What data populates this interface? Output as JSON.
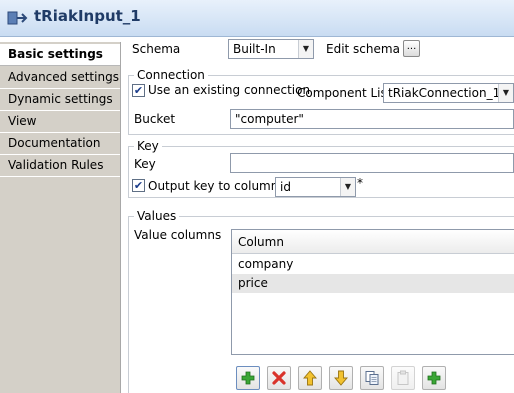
{
  "window": {
    "title": "tRiakInput_1"
  },
  "sidebar": {
    "tabs": [
      {
        "label": "Basic settings"
      },
      {
        "label": "Advanced settings"
      },
      {
        "label": "Dynamic settings"
      },
      {
        "label": "View"
      },
      {
        "label": "Documentation"
      },
      {
        "label": "Validation Rules"
      }
    ],
    "active_index": 0
  },
  "schema": {
    "label": "Schema",
    "value": "Built-In",
    "edit_label": "Edit schema",
    "edit_button": "..."
  },
  "connection": {
    "group_title": "Connection",
    "use_existing_label": "Use an existing connection",
    "use_existing_checked": true,
    "component_list_label": "Component List",
    "component_value": "tRiakConnection_1",
    "bucket_label": "Bucket",
    "bucket_value": "\"computer\""
  },
  "key": {
    "group_title": "Key",
    "key_label": "Key",
    "key_value": "",
    "output_label": "Output key to column",
    "output_checked": true,
    "column_value": "id",
    "required_mark": "*"
  },
  "values": {
    "group_title": "Values",
    "value_columns_label": "Value columns",
    "table": {
      "header": "Column",
      "rows": [
        "company",
        "price"
      ],
      "selected_row": 1
    }
  },
  "toolbar": {
    "buttons": [
      "add-icon",
      "remove-icon",
      "move-up-icon",
      "move-down-icon",
      "copy-icon",
      "paste-icon",
      "import-icon"
    ]
  },
  "colors": {
    "tab_background": "#d4d0c8",
    "add_green": "#3aa635",
    "remove_red": "#d9332b",
    "arrow_yellow": "#f2c230"
  }
}
